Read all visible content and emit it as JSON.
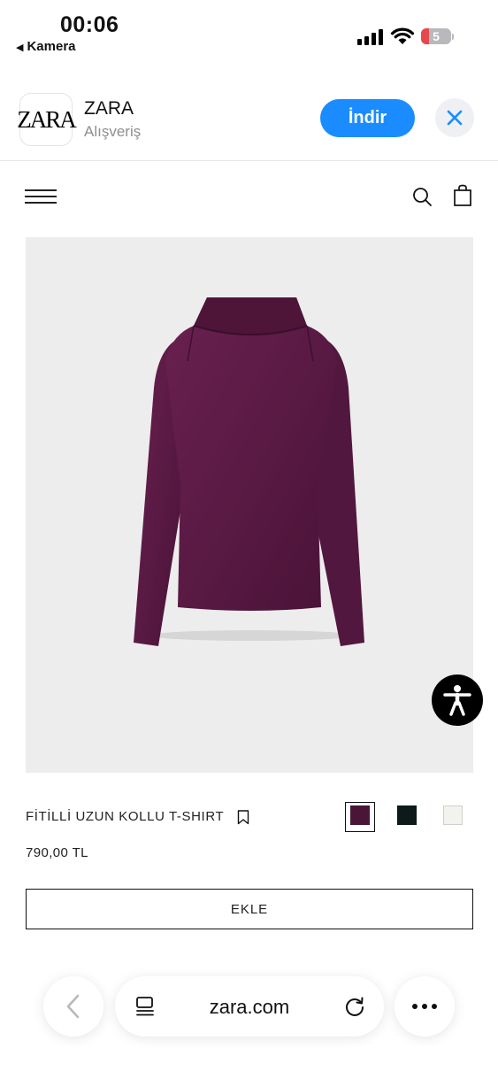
{
  "status_bar": {
    "time": "00:06",
    "back_app": "Kamera",
    "battery_level": "5"
  },
  "app_banner": {
    "icon_text": "ZARA",
    "app_name": "ZARA",
    "category": "Alışveriş",
    "get_label": "İndir"
  },
  "header": {
    "icons": [
      "menu-icon",
      "search-icon",
      "shopping-bag-icon"
    ]
  },
  "product": {
    "name": "FİTİLLİ UZUN KOLLU T-SHIRT",
    "price": "790,00 TL",
    "add_label": "EKLE",
    "colors": [
      {
        "hex": "#4b1537",
        "selected": true
      },
      {
        "hex": "#0c1a1a",
        "selected": false
      },
      {
        "hex": "#f3f2ec",
        "selected": false
      }
    ]
  },
  "browser": {
    "url": "zara.com"
  }
}
